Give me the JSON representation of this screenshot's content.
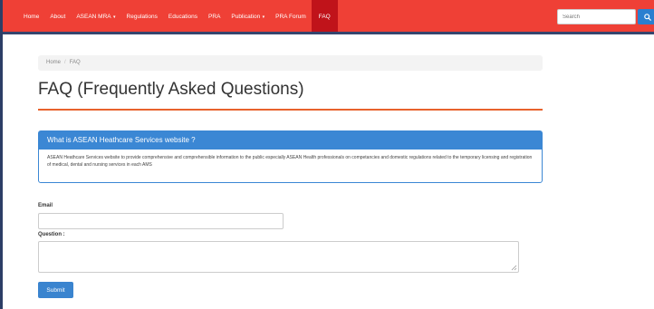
{
  "navbar": {
    "items": [
      {
        "label": "Home"
      },
      {
        "label": "About"
      },
      {
        "label": "ASEAN MRA",
        "dropdown": true
      },
      {
        "label": "Regulations"
      },
      {
        "label": "Educations"
      },
      {
        "label": "PRA"
      },
      {
        "label": "Publication",
        "dropdown": true
      },
      {
        "label": "PRA Forum"
      },
      {
        "label": "FAQ",
        "active": true
      }
    ],
    "search_placeholder": "Search",
    "search_icon": "search-icon",
    "color": "#ef4036",
    "active_color": "#c0131a"
  },
  "breadcrumb": {
    "home": "Home",
    "separator": "/",
    "current": "FAQ"
  },
  "page": {
    "title": "FAQ (Frequently Asked Questions)",
    "accent_color": "#e8622c"
  },
  "faq": {
    "question": "What is ASEAN Heathcare Services website ?",
    "answer": "ASEAN Heathcare Services website to provide comprehensive and comprehensible information to the public especially ASEAN Health professionals on competancies and domestic regulations related to the temporary licensing and registration of medical, dental and nursing services in each AMS",
    "color": "#3b87d4"
  },
  "form": {
    "email_label": "Email",
    "email_value": "",
    "question_label": "Question :",
    "question_value": "",
    "submit_label": "Submit",
    "button_color": "#3a84cf"
  }
}
